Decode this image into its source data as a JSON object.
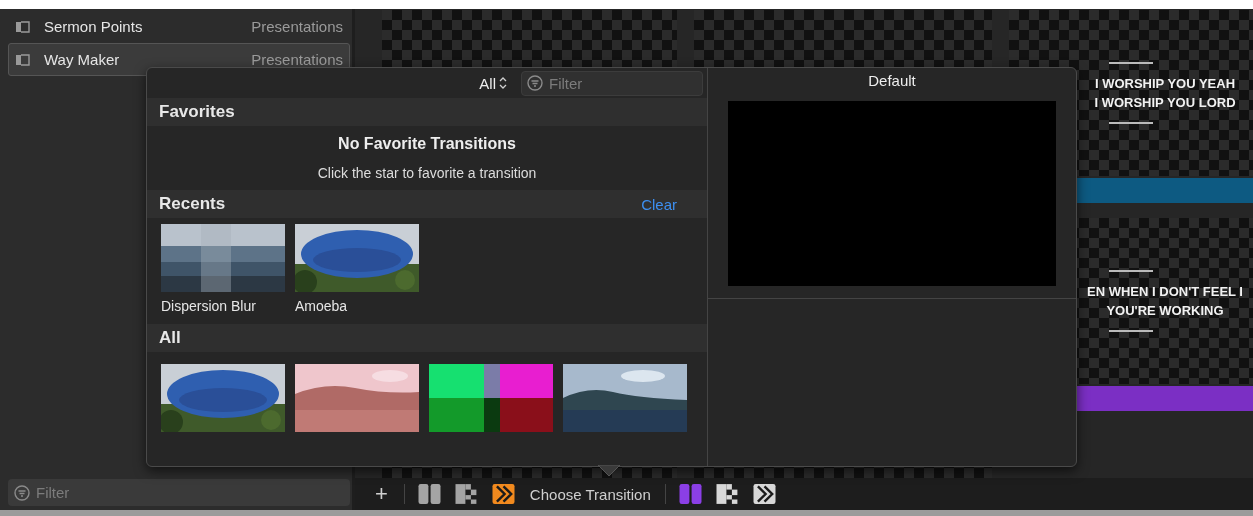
{
  "sidebar": {
    "items": [
      {
        "name": "Sermon Points",
        "type": "Presentations",
        "selected": false
      },
      {
        "name": "Way Maker",
        "type": "Presentations",
        "selected": true
      }
    ],
    "filter": {
      "placeholder": "Filter"
    }
  },
  "slides": [
    {
      "lines": [
        "I WORSHIP YOU YEAH",
        "I WORSHIP YOU LORD"
      ],
      "color": "#0d5a82"
    },
    {
      "lines": [
        "EN WHEN I DON'T FEEL I",
        "YOU'RE WORKING"
      ],
      "color": "#7b2fc4"
    }
  ],
  "popover": {
    "scope": "All",
    "filter": {
      "placeholder": "Filter"
    },
    "favorites": {
      "title": "Favorites",
      "empty_title": "No Favorite Transitions",
      "empty_hint": "Click the star to favorite a transition"
    },
    "recents": {
      "title": "Recents",
      "clear": "Clear",
      "items": [
        {
          "label": "Dispersion Blur"
        },
        {
          "label": "Amoeba"
        }
      ]
    },
    "all": {
      "title": "All"
    },
    "preview": {
      "title": "Default"
    }
  },
  "toolbar": {
    "add": "+",
    "label": "Choose Transition",
    "groups": [
      {
        "color": "#f28a1e",
        "items": [
          {
            "kind": "split",
            "selected": false
          },
          {
            "kind": "checker",
            "selected": false
          },
          {
            "kind": "arrow",
            "selected": true
          }
        ]
      },
      {
        "color": "#8b3fe6",
        "items": [
          {
            "kind": "split",
            "selected": true
          },
          {
            "kind": "checker",
            "selected": false
          },
          {
            "kind": "arrow",
            "selected": false
          }
        ]
      }
    ]
  }
}
